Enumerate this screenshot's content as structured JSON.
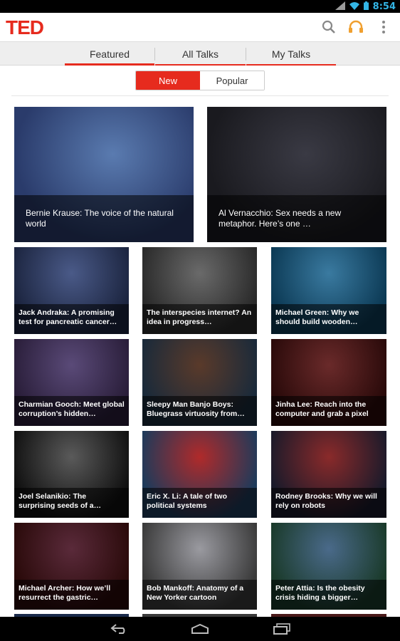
{
  "status_bar": {
    "time": "8:54",
    "icons": [
      "wifi-icon",
      "signal-icon",
      "battery-icon"
    ]
  },
  "app": {
    "logo": "TED",
    "accent": "#e62b1e"
  },
  "tabs": [
    {
      "label": "Featured",
      "active": true
    },
    {
      "label": "All Talks",
      "active": false
    },
    {
      "label": "My Talks",
      "active": false
    }
  ],
  "filter": {
    "new_label": "New",
    "popular_label": "Popular",
    "selected": "New"
  },
  "featured": [
    {
      "title": "Bernie Krause: The voice of the natural world",
      "bg": [
        "#2a3b6b",
        "#5a7bb0"
      ]
    },
    {
      "title": "Al Vernacchio: Sex needs a new metaphor. Here’s one …",
      "bg": [
        "#1a1a1f",
        "#3a3a44"
      ]
    }
  ],
  "talks": [
    {
      "title": "Jack Andraka: A promising test for pancreatic cancer…",
      "bg": [
        "#1c2540",
        "#4a5a88"
      ]
    },
    {
      "title": "The interspecies internet? An idea in progress…",
      "bg": [
        "#2a2a2a",
        "#6a6a6a"
      ]
    },
    {
      "title": "Michael Green: Why we should build wooden…",
      "bg": [
        "#0c3a55",
        "#3a7aa0"
      ]
    },
    {
      "title": "Charmian Gooch: Meet global corruption’s hidden…",
      "bg": [
        "#2a1e3a",
        "#5a4a78"
      ]
    },
    {
      "title": "Sleepy Man Banjo Boys: Bluegrass virtuosity from…",
      "bg": [
        "#1a2a3a",
        "#5a3a2a"
      ]
    },
    {
      "title": "Jinha Lee: Reach into the computer and grab a pixel",
      "bg": [
        "#2a0a0a",
        "#6a2a2a"
      ]
    },
    {
      "title": "Joel Selanikio: The surprising seeds of a…",
      "bg": [
        "#111111",
        "#5a5a5a"
      ]
    },
    {
      "title": "Eric X. Li: A tale of two political systems",
      "bg": [
        "#1e3a5a",
        "#b02a2a"
      ]
    },
    {
      "title": "Rodney Brooks: Why we will rely on robots",
      "bg": [
        "#1a1a2a",
        "#8a2a2a"
      ]
    },
    {
      "title": "Michael Archer: How we’ll resurrect the gastric…",
      "bg": [
        "#2a0a0a",
        "#5a2a3a"
      ]
    },
    {
      "title": "Bob Mankoff: Anatomy of a New Yorker cartoon",
      "bg": [
        "#3a3a3a",
        "#9a9aa0"
      ]
    },
    {
      "title": "Peter Attia: Is the obesity crisis hiding a bigger…",
      "bg": [
        "#1a3a2a",
        "#4a6a8a"
      ]
    }
  ],
  "nav": [
    "back-icon",
    "home-icon",
    "recent-apps-icon"
  ]
}
